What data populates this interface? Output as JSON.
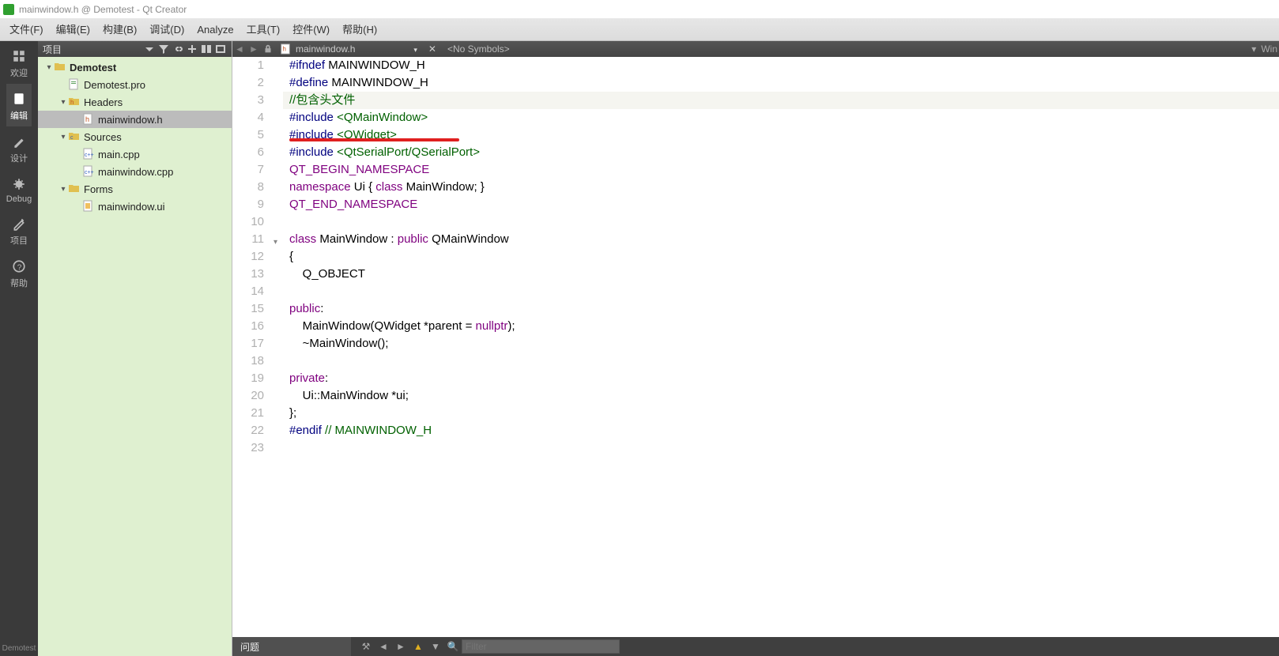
{
  "window": {
    "title": "mainwindow.h @ Demotest - Qt Creator"
  },
  "menu": [
    "文件(F)",
    "编辑(E)",
    "构建(B)",
    "调试(D)",
    "Analyze",
    "工具(T)",
    "控件(W)",
    "帮助(H)"
  ],
  "modes": [
    {
      "label": "欢迎"
    },
    {
      "label": "编辑",
      "selected": true
    },
    {
      "label": "设计"
    },
    {
      "label": "Debug"
    },
    {
      "label": "项目"
    },
    {
      "label": "帮助"
    }
  ],
  "mode_footer": "Demotest",
  "project_panel": {
    "title": "项目",
    "tree": [
      {
        "depth": 0,
        "expander": "▾",
        "icon": "folder",
        "label": "Demotest",
        "bold": true
      },
      {
        "depth": 1,
        "expander": "",
        "icon": "profile",
        "label": "Demotest.pro"
      },
      {
        "depth": 1,
        "expander": "▾",
        "icon": "hfolder",
        "label": "Headers"
      },
      {
        "depth": 2,
        "expander": "",
        "icon": "hfile",
        "label": "mainwindow.h",
        "selected": true
      },
      {
        "depth": 1,
        "expander": "▾",
        "icon": "sfolder",
        "label": "Sources"
      },
      {
        "depth": 2,
        "expander": "",
        "icon": "cpp",
        "label": "main.cpp"
      },
      {
        "depth": 2,
        "expander": "",
        "icon": "cpp",
        "label": "mainwindow.cpp"
      },
      {
        "depth": 1,
        "expander": "▾",
        "icon": "ffolder",
        "label": "Forms"
      },
      {
        "depth": 2,
        "expander": "",
        "icon": "ui",
        "label": "mainwindow.ui"
      }
    ]
  },
  "editor_tab": {
    "filename": "mainwindow.h",
    "symbols": "<No Symbols>",
    "right_label": "Win"
  },
  "code": {
    "lines": [
      {
        "n": 1,
        "tokens": [
          [
            "c-pre",
            "#ifndef"
          ],
          [
            "",
            " MAINWINDOW_H"
          ]
        ]
      },
      {
        "n": 2,
        "tokens": [
          [
            "c-pre",
            "#define"
          ],
          [
            "",
            " MAINWINDOW_H"
          ]
        ]
      },
      {
        "n": 3,
        "tokens": [
          [
            "c-inc",
            "//包含头文件"
          ]
        ],
        "cursor": true
      },
      {
        "n": 4,
        "tokens": [
          [
            "c-pre",
            "#include"
          ],
          [
            "",
            " "
          ],
          [
            "c-inc",
            "<QMainWindow>"
          ]
        ]
      },
      {
        "n": 5,
        "tokens": [
          [
            "c-pre",
            "#include"
          ],
          [
            "",
            " "
          ],
          [
            "c-inc",
            "<QWidget>"
          ]
        ],
        "annot": true
      },
      {
        "n": 6,
        "tokens": [
          [
            "c-pre",
            "#include"
          ],
          [
            "",
            " "
          ],
          [
            "c-inc",
            "<QtSerialPort/QSerialPort>"
          ]
        ]
      },
      {
        "n": 7,
        "tokens": [
          [
            "c-kw",
            "QT_BEGIN_NAMESPACE"
          ]
        ]
      },
      {
        "n": 8,
        "tokens": [
          [
            "c-kw",
            "namespace"
          ],
          [
            "",
            " Ui { "
          ],
          [
            "c-kw",
            "class"
          ],
          [
            "",
            " MainWindow; }"
          ]
        ]
      },
      {
        "n": 9,
        "tokens": [
          [
            "c-kw",
            "QT_END_NAMESPACE"
          ]
        ]
      },
      {
        "n": 10,
        "tokens": [
          [
            "",
            ""
          ]
        ]
      },
      {
        "n": 11,
        "tokens": [
          [
            "c-kw",
            "class"
          ],
          [
            "",
            " MainWindow : "
          ],
          [
            "c-kw",
            "public"
          ],
          [
            "",
            " QMainWindow"
          ]
        ],
        "fold": true
      },
      {
        "n": 12,
        "tokens": [
          [
            "",
            "{"
          ]
        ]
      },
      {
        "n": 13,
        "tokens": [
          [
            "",
            "    Q_OBJECT"
          ]
        ]
      },
      {
        "n": 14,
        "tokens": [
          [
            "",
            ""
          ]
        ]
      },
      {
        "n": 15,
        "tokens": [
          [
            "c-kw",
            "public"
          ],
          [
            "",
            ":"
          ]
        ]
      },
      {
        "n": 16,
        "tokens": [
          [
            "",
            "    MainWindow(QWidget *parent = "
          ],
          [
            "c-nul",
            "nullptr"
          ],
          [
            "",
            ");"
          ]
        ]
      },
      {
        "n": 17,
        "tokens": [
          [
            "",
            "    ~MainWindow();"
          ]
        ]
      },
      {
        "n": 18,
        "tokens": [
          [
            "",
            ""
          ]
        ]
      },
      {
        "n": 19,
        "tokens": [
          [
            "c-kw",
            "private"
          ],
          [
            "",
            ":"
          ]
        ]
      },
      {
        "n": 20,
        "tokens": [
          [
            "",
            "    Ui::MainWindow *ui;"
          ]
        ]
      },
      {
        "n": 21,
        "tokens": [
          [
            "",
            "};"
          ]
        ]
      },
      {
        "n": 22,
        "tokens": [
          [
            "c-pre",
            "#endif"
          ],
          [
            "",
            " "
          ],
          [
            "c-inc",
            "// MAINWINDOW_H"
          ]
        ]
      },
      {
        "n": 23,
        "tokens": [
          [
            "",
            ""
          ]
        ]
      }
    ]
  },
  "problems": {
    "label": "问题",
    "filter_placeholder": "Filter"
  }
}
